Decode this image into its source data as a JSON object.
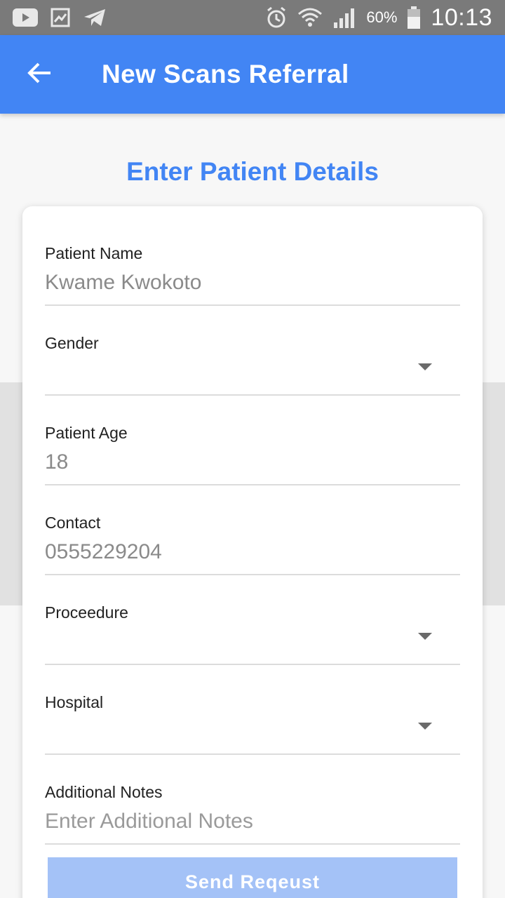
{
  "status_bar": {
    "icons_left": [
      "youtube-icon",
      "gallery-icon",
      "telegram-icon"
    ],
    "icons_right": [
      "alarm-icon",
      "wifi-icon",
      "signal-icon",
      "battery-icon"
    ],
    "battery": "60%",
    "time": "10:13"
  },
  "app_bar": {
    "title": "New Scans Referral",
    "back_icon": "arrow-back-icon",
    "color": "#4285f4"
  },
  "form": {
    "heading": "Enter Patient Details",
    "fields": [
      {
        "label": "Patient Name",
        "value": "Kwame Kwokoto",
        "type": "text"
      },
      {
        "label": "Gender",
        "value": "",
        "type": "dropdown"
      },
      {
        "label": "Patient Age",
        "value": "18",
        "type": "text"
      },
      {
        "label": "Contact",
        "value": "0555229204",
        "type": "text"
      },
      {
        "label": "Proceedure",
        "value": "",
        "type": "dropdown"
      },
      {
        "label": "Hospital",
        "value": "",
        "type": "dropdown"
      },
      {
        "label": "Additional Notes",
        "value": "",
        "placeholder": "Enter Additional Notes",
        "type": "text"
      }
    ],
    "submit_label": "Send Reqeust",
    "submit_color": "#a4c2f7"
  }
}
